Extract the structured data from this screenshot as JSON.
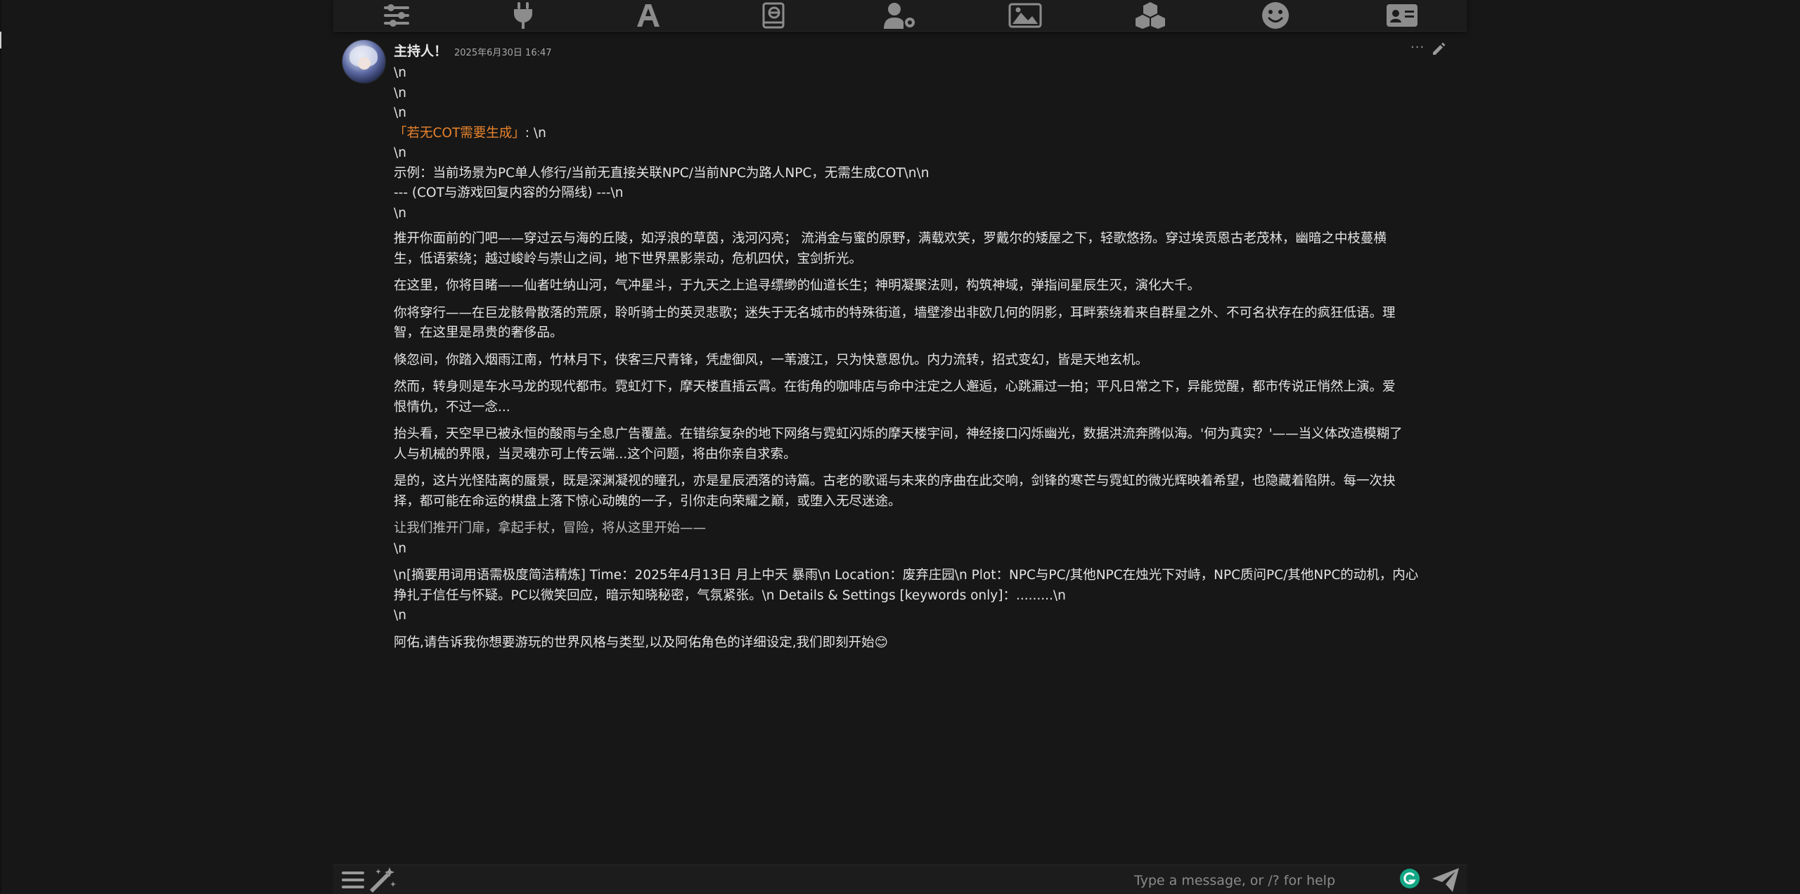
{
  "top_toolbar": {
    "icons": [
      "sliders-icon",
      "plug-icon",
      "font-icon",
      "book-atlas-icon",
      "user-gear-icon",
      "image-icon",
      "cubes-icon",
      "face-smile-icon",
      "id-card-icon"
    ]
  },
  "message": {
    "name": "主持人！",
    "timestamp": "2025年6月30日 16:47",
    "more_glyph": "···",
    "lines": {
      "l1": "\\n",
      "l2": "\\n",
      "l3": "\\n",
      "l4_highlight": "「若无COT需要生成」",
      "l4_rest": ": \\n",
      "l5": "\\n",
      "l6": "示例：当前场景为PC单人修行/当前无直接关联NPC/当前NPC为路人NPC，无需生成COT\\n\\n",
      "l7": "--- (COT与游戏回复内容的分隔线) ---\\n",
      "l8": "\\n"
    },
    "paragraphs": {
      "p1a": "推开你面前的门吧——穿过云与海的丘陵，如浮浪的草茵，浅河闪亮； 流消金与蜜的原野，满载欢笑，罗戴尔的矮屋之下，轻歌悠扬。穿过埃贡恩古老茂林，幽暗之中枝蔓横",
      "p1b": "生，低语萦绕；越过峻岭与崇山之间，地下世界黑影祟动，危机四伏，宝剑折光。",
      "p2": "在这里，你将目睹——仙者吐纳山河，气冲星斗，于九天之上追寻缥缈的仙道长生；神明凝聚法则，构筑神域，弹指间星辰生灭，演化大千。",
      "p3a": "你将穿行——在巨龙骸骨散落的荒原，聆听骑士的英灵悲歌；迷失于无名城市的特殊街道，墙壁渗出非欧几何的阴影，耳畔萦绕着来自群星之外、不可名状存在的疯狂低语。理",
      "p3b": "智，在这里是昂贵的奢侈品。",
      "p4": "倏忽间，你踏入烟雨江南，竹林月下，侠客三尺青锋，凭虚御风，一苇渡江，只为快意恩仇。内力流转，招式变幻，皆是天地玄机。",
      "p5a": "然而，转身则是车水马龙的现代都市。霓虹灯下，摩天楼直插云霄。在街角的咖啡店与命中注定之人邂逅，心跳漏过一拍；平凡日常之下，异能觉醒，都市传说正悄然上演。爱",
      "p5b": "恨情仇，不过一念...",
      "p6a": "抬头看，天空早已被永恒的酸雨与全息广告覆盖。在错综复杂的地下网络与霓虹闪烁的摩天楼宇间，神经接口闪烁幽光，数据洪流奔腾似海。'何为真实？'——当义体改造模糊了",
      "p6b": "人与机械的界限，当灵魂亦可上传云端...这个问题，将由你亲自求索。",
      "p7a": "是的，这片光怪陆离的蜃景，既是深渊凝视的瞳孔，亦是星辰洒落的诗篇。古老的歌谣与未来的序曲在此交响，剑锋的寒芒与霓虹的微光辉映着希望，也隐藏着陷阱。每一次抉",
      "p7b": "择，都可能在命运的棋盘上落下惊心动魄的一子，引你走向荣耀之巅，或堕入无尽迷途。",
      "p8": "让我们推开门扉，拿起手杖，冒险，将从这里开始——",
      "p8b": "\\n",
      "p9a": "\\n[摘要用词用语需极度简洁精炼] Time：2025年4月13日 月上中天 暴雨\\n Location：废弃庄园\\n Plot：NPC与PC/其他NPC在烛光下对峙，NPC质问PC/其他NPC的动机，内心",
      "p9b": "挣扎于信任与怀疑。PC以微笑回应，暗示知晓秘密，气氛紧张。\\n Details & Settings [keywords only]：.........\\n",
      "p9c": "\\n",
      "p10": "阿佑,请告诉我你想要游玩的世界风格与类型,以及阿佑角色的详细设定,我们即刻开始",
      "p10_emoji": "😊"
    }
  },
  "send_form": {
    "placeholder": "Type a message, or /? for help"
  },
  "colors": {
    "accent_orange": "#e8832c",
    "background": "#171717",
    "grammarly_green": "#15a785"
  }
}
